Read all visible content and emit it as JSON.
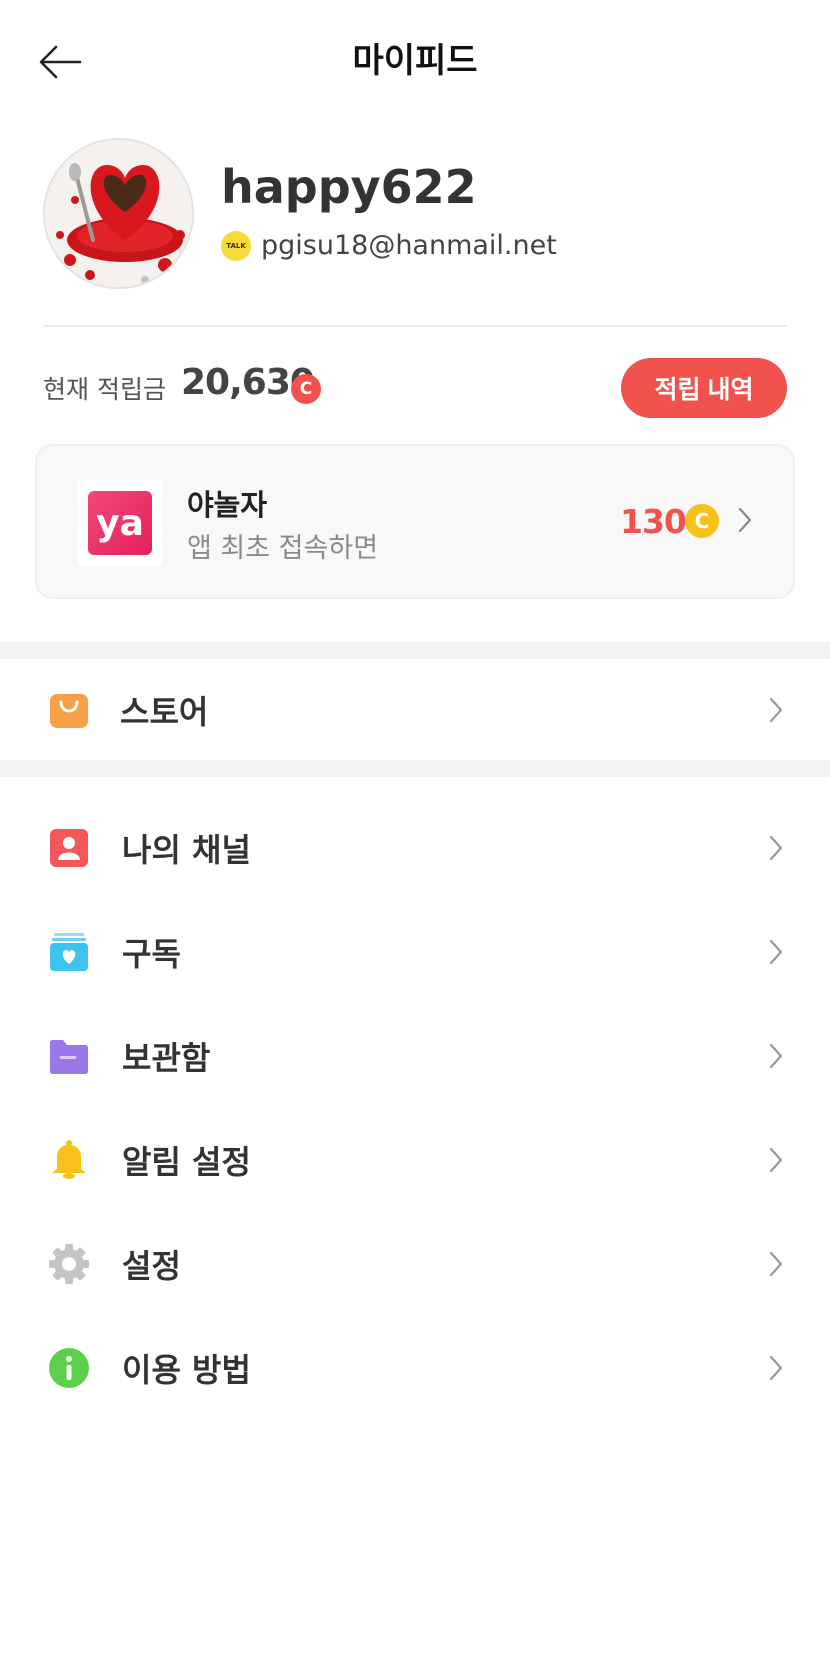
{
  "header": {
    "title": "마이피드",
    "back_icon": "arrow-left-icon"
  },
  "profile": {
    "username": "happy622",
    "email": "pgisu18@hanmail.net",
    "login_badge": "TALK"
  },
  "points": {
    "label": "현재 적립금",
    "value": "20,630",
    "coin_symbol": "C",
    "history_button": "적립 내역"
  },
  "promo": {
    "logo_text": "ya",
    "title": "야놀자",
    "subtitle": "앱 최초 접속하면",
    "reward": "130",
    "coin_symbol": "C"
  },
  "store": {
    "label": "스토어",
    "icon": "shopping-bag-icon"
  },
  "menu": [
    {
      "label": "나의 채널",
      "icon": "my-channel-icon"
    },
    {
      "label": "구독",
      "icon": "subscription-icon"
    },
    {
      "label": "보관함",
      "icon": "folder-icon"
    },
    {
      "label": "알림 설정",
      "icon": "bell-icon"
    },
    {
      "label": "설정",
      "icon": "gear-icon"
    },
    {
      "label": "이용 방법",
      "icon": "info-icon"
    }
  ],
  "colors": {
    "accent_red": "#f2524e",
    "coin_yellow": "#f6c21a",
    "store_orange": "#f6a14a",
    "channel_red": "#f2575a",
    "subscribe_blue": "#3ec2f0",
    "folder_purple": "#9b78ea",
    "bell_yellow": "#f8c21b",
    "gear_gray": "#c4c4c4",
    "info_green": "#5cd04a"
  }
}
